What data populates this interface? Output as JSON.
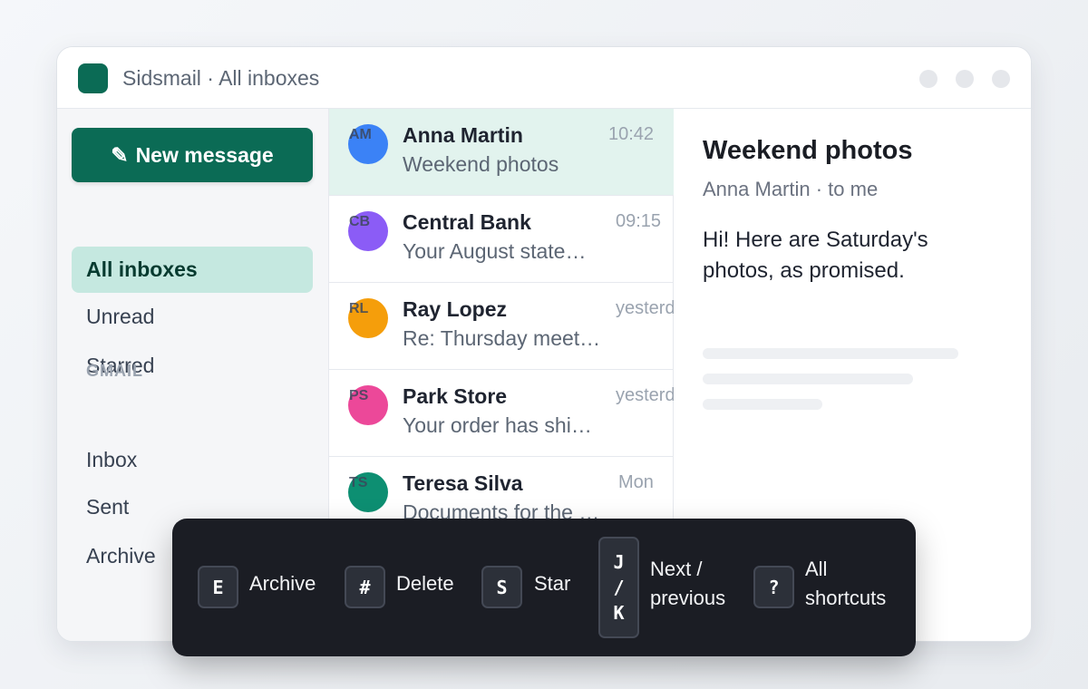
{
  "window": {
    "title": "Sidsmail · All inboxes"
  },
  "sidebar": {
    "new_message_icon": "✎",
    "new_message_label": "New message",
    "items": [
      {
        "label": "All inboxes"
      },
      {
        "label": "Unread"
      },
      {
        "label": "Starred"
      }
    ],
    "section_label": "GMAIL",
    "section_items": [
      {
        "label": "Inbox"
      },
      {
        "label": "Sent"
      },
      {
        "label": "Archive"
      }
    ]
  },
  "messages": [
    {
      "initials": "AM",
      "sender": "Anna Martin",
      "time": "10:42",
      "preview": "Weekend photos",
      "avatar_color": "#3b82f6"
    },
    {
      "initials": "CB",
      "sender": "Central Bank",
      "time": "09:15",
      "preview": "Your August state…",
      "avatar_color": "#8b5cf6"
    },
    {
      "initials": "RL",
      "sender": "Ray Lopez",
      "time": "yesterday",
      "preview": "Re: Thursday meet…",
      "avatar_color": "#f59e0b"
    },
    {
      "initials": "PS",
      "sender": "Park Store",
      "time": "yesterday",
      "preview": "Your order has shi…",
      "avatar_color": "#ec4899"
    },
    {
      "initials": "TS",
      "sender": "Teresa Silva",
      "time": "Mon",
      "preview": "Documents for the …",
      "avatar_color": "#0d8f72"
    }
  ],
  "reader": {
    "subject": "Weekend photos",
    "meta": "Anna Martin · to me",
    "body": "Hi! Here are Saturday's photos, as promised."
  },
  "shortcuts": [
    {
      "key": "E",
      "label": "Archive"
    },
    {
      "key": "#",
      "label": "Delete"
    },
    {
      "key": "S",
      "label": "Star"
    },
    {
      "keys": [
        "J",
        "/",
        "K"
      ],
      "label_line1": "Next /",
      "label_line2": "previous"
    },
    {
      "key": "?",
      "label_line1": "All",
      "label_line2": "shortcuts"
    }
  ],
  "colors": {
    "brand": "#0b6b55",
    "selected_nav": "#c5e8e0",
    "selected_row": "#e2f3ee",
    "overlay": "#1b1d24"
  }
}
